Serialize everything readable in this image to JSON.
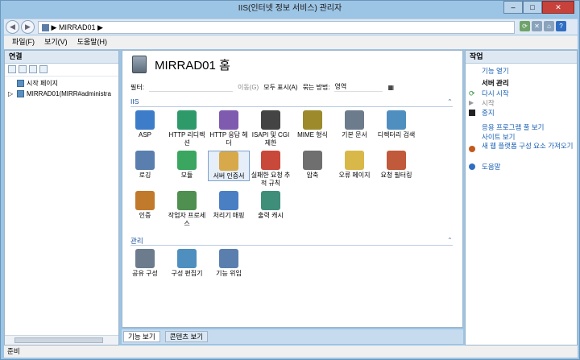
{
  "window": {
    "title": "IIS(인터넷 정보 서비스) 관리자",
    "min": "–",
    "max": "□",
    "close": "✕"
  },
  "address": {
    "path": "MIRRAD01",
    "sep": "▶",
    "tail_sep": "▶",
    "back": "◀",
    "forward": "▶",
    "help": "?"
  },
  "menu": [
    "파일(F)",
    "보기(V)",
    "도움말(H)"
  ],
  "connections": {
    "title": "연결",
    "tree": [
      {
        "label": "시작 페이지",
        "expander": ""
      },
      {
        "label": "MIRRAD01(MIRR#administra",
        "expander": "▷"
      }
    ]
  },
  "center": {
    "title": "MIRRAD01 홈",
    "filter_label": "필터:",
    "go_label": "이동(G)",
    "show_all_label": "모두 표시(A)",
    "group_label": "묶는 방법:",
    "group_value": "영역",
    "sections": [
      {
        "title": "IIS",
        "features": [
          "ASP",
          "HTTP 리디렉션",
          "HTTP 응답 헤더",
          "ISAPI 및 CGI 제한",
          "MIME 형식",
          "기본 문서",
          "디렉터리 검색",
          "로깅",
          "모듈",
          "서버 인증서",
          "실패한 요청 추적 규칙",
          "압축",
          "오류 페이지",
          "요청 필터링",
          "인증",
          "작업자 프로세스",
          "처리기 매핑",
          "출력 캐시"
        ]
      },
      {
        "title": "관리",
        "features": [
          "공유 구성",
          "구성 편집기",
          "기능 위임"
        ]
      }
    ],
    "tabs": [
      "기능 보기",
      "콘텐츠 보기"
    ]
  },
  "actions": {
    "title": "작업",
    "open_feature": "기능 열기",
    "server_manage": "서버 관리",
    "restart": "다시 시작",
    "start": "시작",
    "stop": "중지",
    "app_pool_defaults": "응용 프로그램 풀 보기",
    "view_sites": "사이트 보기",
    "get_new_components": "새 웹 플랫폼 구성 요소 가져오기",
    "help": "도움말"
  },
  "status": "준비",
  "colors": {
    "accent": "#1a5fb4",
    "close": "#c7423a"
  }
}
